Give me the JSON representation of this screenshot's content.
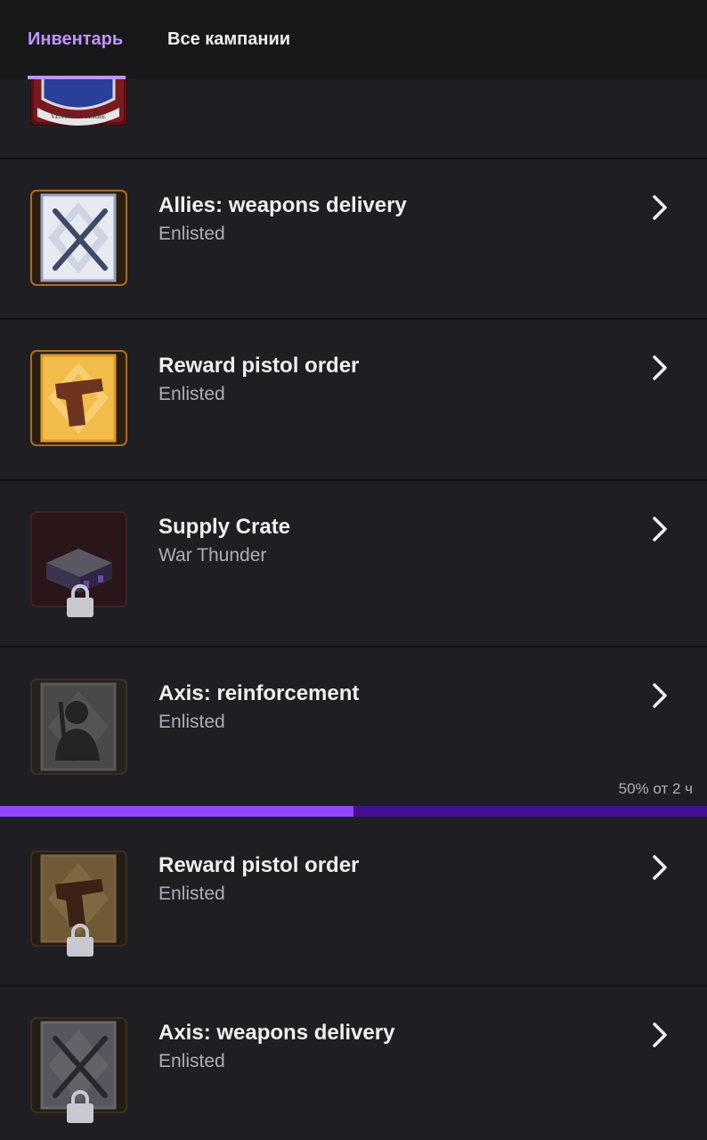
{
  "tabs": [
    {
      "label": "Инвентарь",
      "active": true
    },
    {
      "label": "Все кампании",
      "active": false
    }
  ],
  "items": [
    {
      "title": "",
      "game": "",
      "icon": "regiment-crest-icon",
      "motto": "VENTRE A TERRE",
      "locked": false
    },
    {
      "title": "Allies: weapons delivery",
      "game": "Enlisted",
      "icon": "crossed-rifles-icon",
      "locked": false
    },
    {
      "title": "Reward pistol order",
      "game": "Enlisted",
      "icon": "pistol-icon",
      "locked": false
    },
    {
      "title": "Supply Crate",
      "game": "War Thunder",
      "icon": "supply-crate-icon",
      "locked": true
    },
    {
      "title": "Axis: reinforcement",
      "game": "Enlisted",
      "icon": "soldier-silhouette-icon",
      "locked": false
    },
    {
      "title": "Reward pistol order",
      "game": "Enlisted",
      "icon": "pistol-icon",
      "locked": true
    },
    {
      "title": "Axis: weapons delivery",
      "game": "Enlisted",
      "icon": "crossed-rifles-icon",
      "locked": true
    }
  ],
  "progress": {
    "label": "50% от 2 ч",
    "fraction": 0.5
  },
  "colors": {
    "accent": "#bf94ff",
    "progress_fill": "#9147ff",
    "progress_track": "#451093",
    "background": "#1f1f23"
  }
}
